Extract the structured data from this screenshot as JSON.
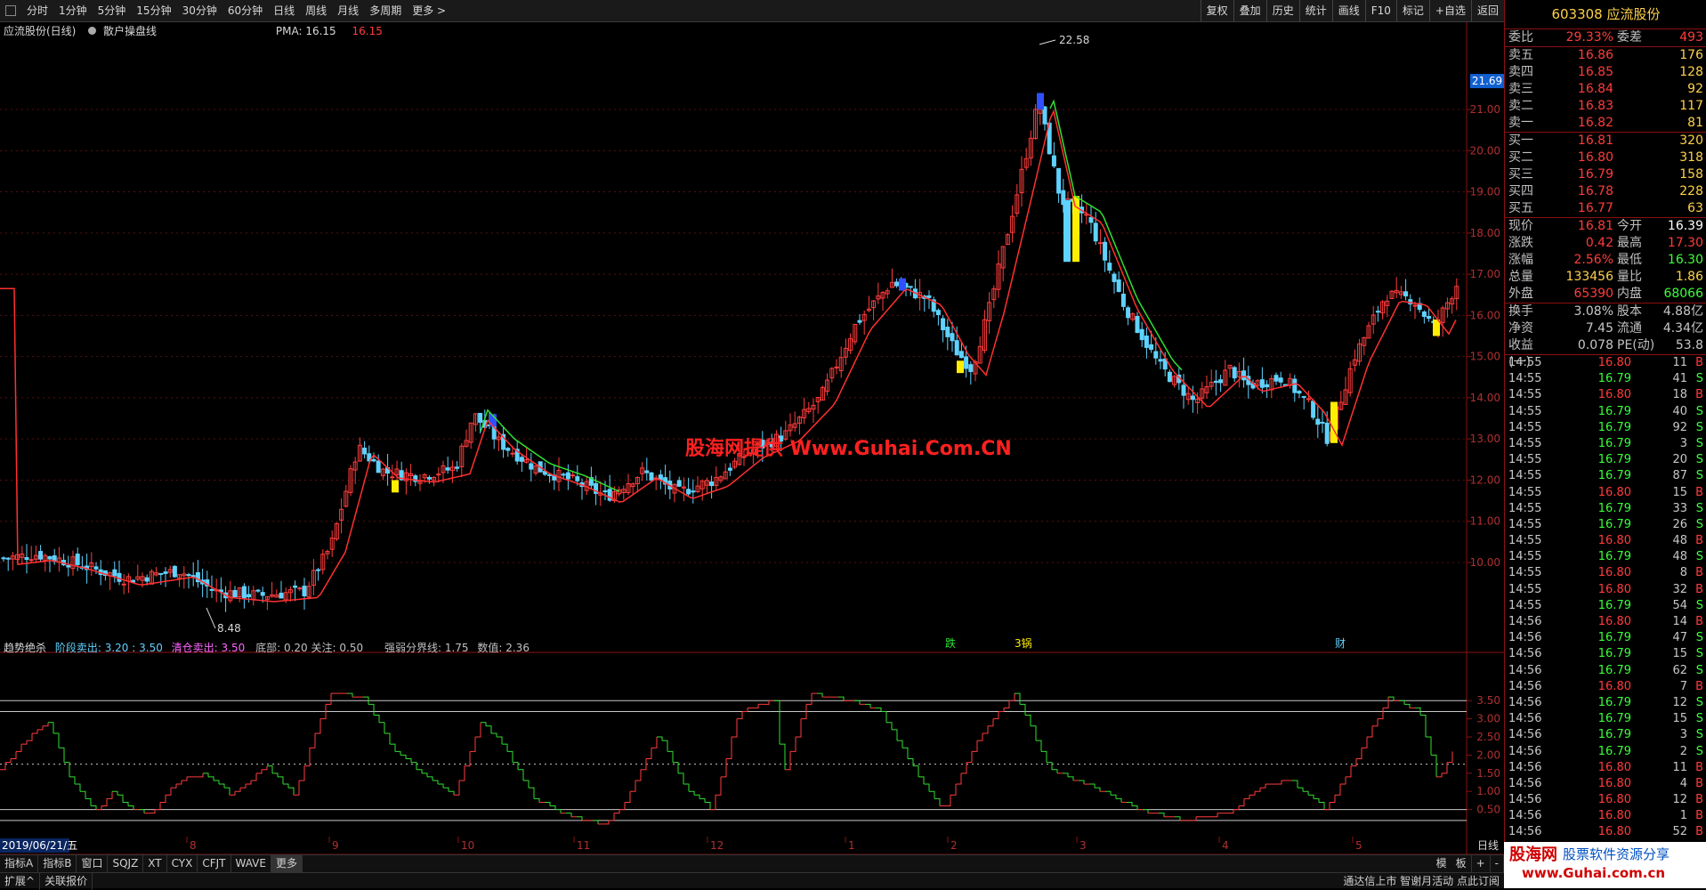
{
  "toolbar": {
    "items": [
      "分时",
      "1分钟",
      "5分钟",
      "15分钟",
      "30分钟",
      "60分钟",
      "日线",
      "周线",
      "月线",
      "多周期",
      "更多 >"
    ],
    "right_items": [
      "复权",
      "叠加",
      "历史",
      "统计",
      "画线",
      "F10",
      "标记",
      "+自选",
      "返回"
    ]
  },
  "chart_header": {
    "name": "应流股份(日线)",
    "indicator": "散户操盘线",
    "pma_label": "PMA: 16.15",
    "pma_value": "16.15"
  },
  "main_chart": {
    "y_ticks": [
      "21.00",
      "20.00",
      "19.00",
      "18.00",
      "17.00",
      "16.00",
      "15.00",
      "14.00",
      "13.00",
      "12.00",
      "11.00",
      "10.00"
    ],
    "current_price_tag": "21.69",
    "high_label": "22.58",
    "low_label": "8.48",
    "markers": [
      "跌",
      "3锅",
      "财"
    ]
  },
  "watermark": "股海网提供 Www.Guhai.Com.CN",
  "sub_chart": {
    "title": "趋势绝杀",
    "params": [
      {
        "label": "阶段卖出:",
        "value": "3.20",
        "color": "#5fd3ff"
      },
      {
        "label": ": 3.50",
        "value": "",
        "color": "#c0c0c0"
      },
      {
        "label": "清仓卖出:",
        "value": "3.50",
        "color": "#ff66ff"
      },
      {
        "label": "底部:",
        "value": "0.20",
        "color": "#c0c0c0"
      },
      {
        "label": "关注:",
        "value": "0.50",
        "color": "#c0c0c0"
      },
      {
        "label": "强弱分界线:",
        "value": "1.75",
        "color": "#c0c0c0"
      },
      {
        "label": "数值:",
        "value": "2.36",
        "color": "#c0c0c0"
      }
    ],
    "y_ticks": [
      "3.50",
      "3.00",
      "2.50",
      "2.00",
      "1.50",
      "1.00",
      "0.50"
    ]
  },
  "x_axis": {
    "date_label": "2019/06/21/五",
    "months": [
      "8",
      "9",
      "10",
      "11",
      "12",
      "1",
      "2",
      "3",
      "4",
      "5"
    ],
    "period": "日线"
  },
  "bottom_tabs": [
    "指标A",
    "指标B",
    "窗口",
    "SQJZ",
    "XT",
    "CYX",
    "CFJT",
    "WAVE",
    "更多"
  ],
  "bottom_row2": [
    "扩展^",
    "关联报价"
  ],
  "bottom_right": [
    "模",
    "板",
    "+",
    "-"
  ],
  "status_text": "通达信上市 智谢月活动 点此订阅",
  "quote": {
    "code": "603308",
    "name": "应流股份",
    "weibi": {
      "label": "委比",
      "value": "29.33%",
      "label2": "委差",
      "value2": "493"
    },
    "sells": [
      {
        "label": "卖五",
        "price": "16.86",
        "vol": "176"
      },
      {
        "label": "卖四",
        "price": "16.85",
        "vol": "128"
      },
      {
        "label": "卖三",
        "price": "16.84",
        "vol": "92"
      },
      {
        "label": "卖二",
        "price": "16.83",
        "vol": "117"
      },
      {
        "label": "卖一",
        "price": "16.82",
        "vol": "81"
      }
    ],
    "buys": [
      {
        "label": "买一",
        "price": "16.81",
        "vol": "320"
      },
      {
        "label": "买二",
        "price": "16.80",
        "vol": "318"
      },
      {
        "label": "买三",
        "price": "16.79",
        "vol": "158"
      },
      {
        "label": "买四",
        "price": "16.78",
        "vol": "228"
      },
      {
        "label": "买五",
        "price": "16.77",
        "vol": "63"
      }
    ],
    "stats": [
      {
        "l1": "现价",
        "v1": "16.81",
        "l2": "今开",
        "v2": "16.39",
        "c1": "#ff3c3c",
        "c2": "#ffffff"
      },
      {
        "l1": "涨跌",
        "v1": "0.42",
        "l2": "最高",
        "v2": "17.30",
        "c1": "#ff3c3c",
        "c2": "#ff3c3c"
      },
      {
        "l1": "涨幅",
        "v1": "2.56%",
        "l2": "最低",
        "v2": "16.30",
        "c1": "#ff3c3c",
        "c2": "#3cff3c"
      },
      {
        "l1": "总量",
        "v1": "133456",
        "l2": "量比",
        "v2": "1.86",
        "c1": "#ffd24a",
        "c2": "#ffd24a"
      },
      {
        "l1": "外盘",
        "v1": "65390",
        "l2": "内盘",
        "v2": "68066",
        "c1": "#ff3c3c",
        "c2": "#3cff3c"
      },
      {
        "l1": "换手",
        "v1": "3.08%",
        "l2": "股本",
        "v2": "4.88亿",
        "c1": "#c8c8c8",
        "c2": "#c8c8c8"
      },
      {
        "l1": "净资",
        "v1": "7.45",
        "l2": "流通",
        "v2": "4.34亿",
        "c1": "#c8c8c8",
        "c2": "#c8c8c8"
      },
      {
        "l1": "收益(一)",
        "v1": "0.078",
        "l2": "PE(动)",
        "v2": "53.8",
        "c1": "#c8c8c8",
        "c2": "#c8c8c8"
      }
    ],
    "trades": [
      {
        "t": "14:55",
        "p": "16.80",
        "v": "11",
        "s": "B"
      },
      {
        "t": "14:55",
        "p": "16.79",
        "v": "41",
        "s": "S"
      },
      {
        "t": "14:55",
        "p": "16.80",
        "v": "18",
        "s": "B"
      },
      {
        "t": "14:55",
        "p": "16.79",
        "v": "40",
        "s": "S"
      },
      {
        "t": "14:55",
        "p": "16.79",
        "v": "92",
        "s": "S"
      },
      {
        "t": "14:55",
        "p": "16.79",
        "v": "3",
        "s": "S"
      },
      {
        "t": "14:55",
        "p": "16.79",
        "v": "20",
        "s": "S"
      },
      {
        "t": "14:55",
        "p": "16.79",
        "v": "87",
        "s": "S"
      },
      {
        "t": "14:55",
        "p": "16.80",
        "v": "15",
        "s": "B"
      },
      {
        "t": "14:55",
        "p": "16.79",
        "v": "33",
        "s": "S"
      },
      {
        "t": "14:55",
        "p": "16.79",
        "v": "26",
        "s": "S"
      },
      {
        "t": "14:55",
        "p": "16.80",
        "v": "48",
        "s": "B"
      },
      {
        "t": "14:55",
        "p": "16.79",
        "v": "48",
        "s": "S"
      },
      {
        "t": "14:55",
        "p": "16.80",
        "v": "8",
        "s": "B"
      },
      {
        "t": "14:55",
        "p": "16.80",
        "v": "32",
        "s": "B"
      },
      {
        "t": "14:55",
        "p": "16.79",
        "v": "54",
        "s": "S"
      },
      {
        "t": "14:56",
        "p": "16.80",
        "v": "14",
        "s": "B"
      },
      {
        "t": "14:56",
        "p": "16.79",
        "v": "47",
        "s": "S"
      },
      {
        "t": "14:56",
        "p": "16.79",
        "v": "15",
        "s": "S"
      },
      {
        "t": "14:56",
        "p": "16.79",
        "v": "62",
        "s": "S"
      },
      {
        "t": "14:56",
        "p": "16.80",
        "v": "7",
        "s": "B"
      },
      {
        "t": "14:56",
        "p": "16.79",
        "v": "12",
        "s": "S"
      },
      {
        "t": "14:56",
        "p": "16.79",
        "v": "15",
        "s": "S"
      },
      {
        "t": "14:56",
        "p": "16.79",
        "v": "3",
        "s": "S"
      },
      {
        "t": "14:56",
        "p": "16.79",
        "v": "2",
        "s": "S"
      },
      {
        "t": "14:56",
        "p": "16.80",
        "v": "11",
        "s": "B"
      },
      {
        "t": "14:56",
        "p": "16.80",
        "v": "4",
        "s": "B"
      },
      {
        "t": "14:56",
        "p": "16.80",
        "v": "12",
        "s": "B"
      },
      {
        "t": "14:56",
        "p": "16.80",
        "v": "1",
        "s": "B"
      },
      {
        "t": "14:56",
        "p": "16.80",
        "v": "52",
        "s": "B"
      }
    ]
  },
  "brand": {
    "name": "股海网",
    "slogan": "股票软件资源分享",
    "url": "www.Guhai.com.cn"
  }
}
